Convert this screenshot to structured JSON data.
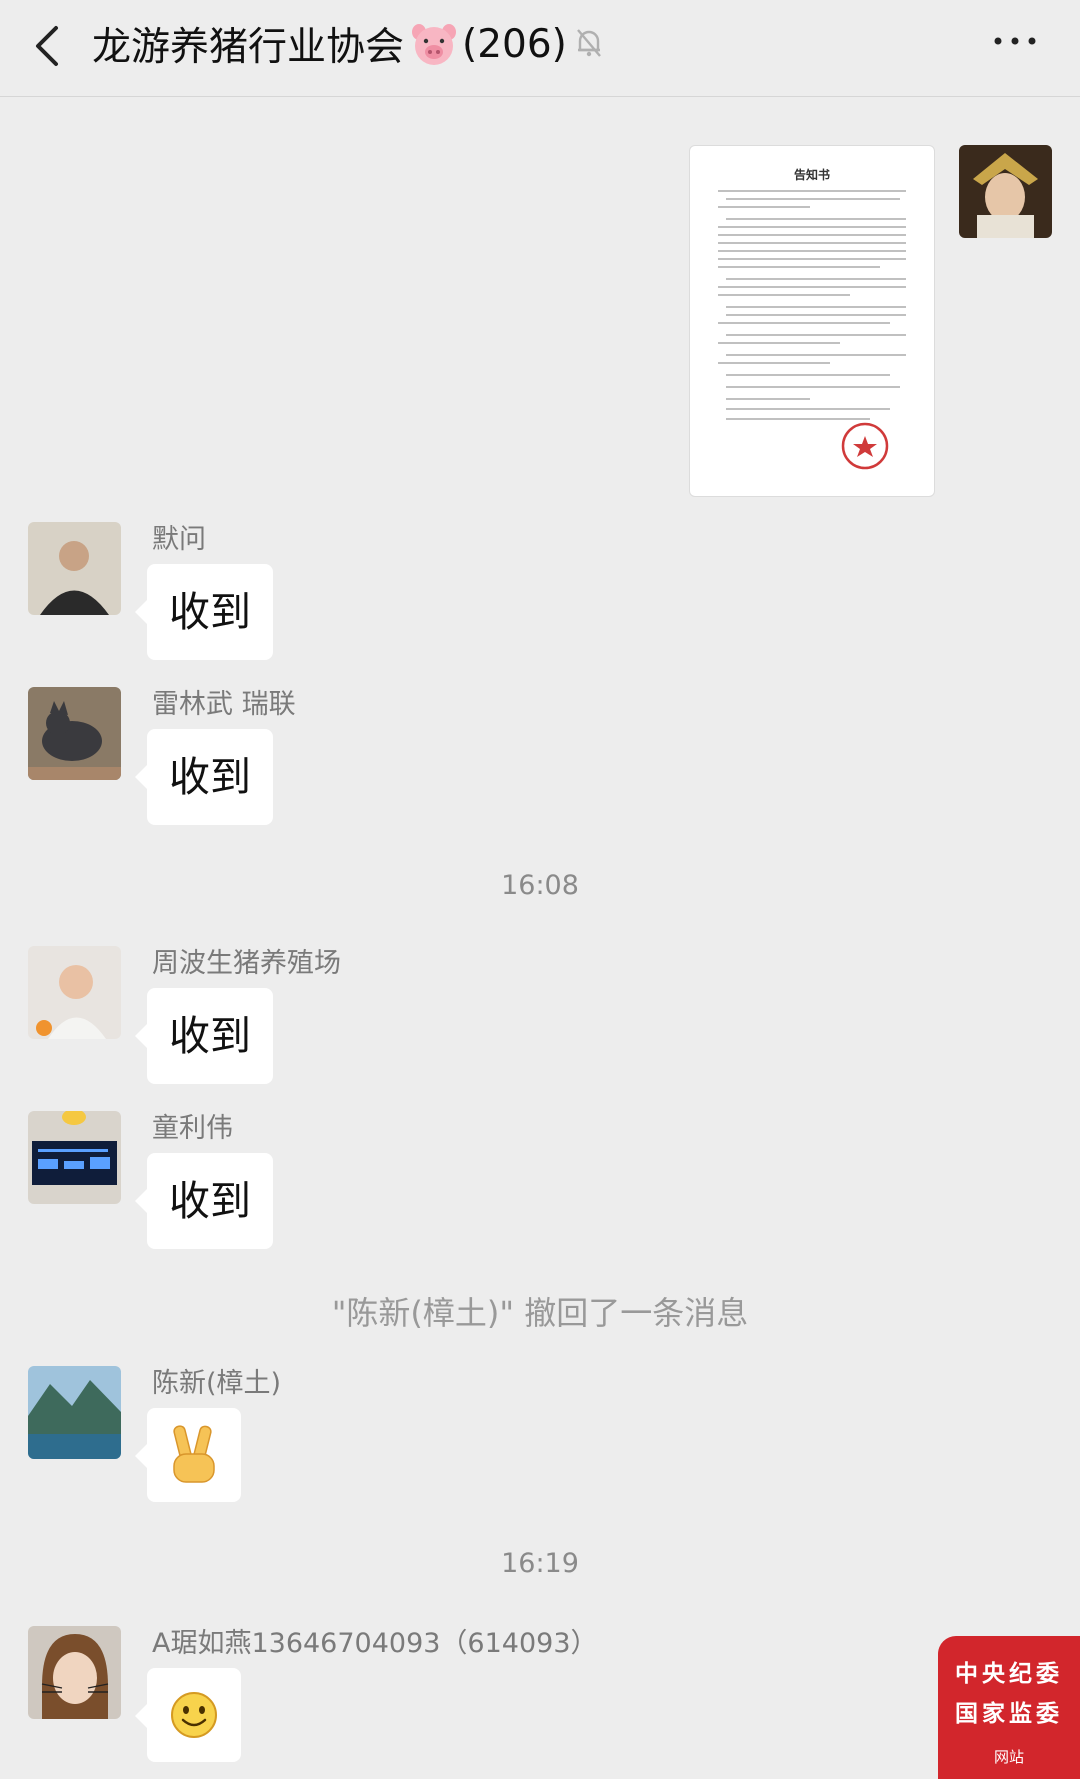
{
  "header": {
    "title": "龙游养猪行业协会",
    "member_count": "(206)",
    "title_icon": "pig-face-emoji",
    "mute_icon": "bell-slash-icon",
    "more_icon": "more-dots-icon"
  },
  "self_message": {
    "document_title": "告知书"
  },
  "messages": [
    {
      "sender": "默问",
      "text": "收到"
    },
    {
      "sender": "雷林武   瑞联",
      "text": "收到"
    },
    {
      "sender": "周波生猪养殖场",
      "text": "收到"
    },
    {
      "sender": "童利伟",
      "text": "收到"
    },
    {
      "sender": "陈新(樟土)",
      "emoji": "victory-hand-emoji"
    },
    {
      "sender": "A琚如燕13646704093（614093）",
      "emoji": "smiling-face-emoji"
    }
  ],
  "timestamps": [
    "16:08",
    "16:19"
  ],
  "recall_notice": "\"陈新(樟土)\" 撤回了一条消息",
  "watermark": {
    "line1": "中央纪委",
    "line2": "国家监委",
    "line3": "网站"
  },
  "colors": {
    "background": "#ededed",
    "bubble": "#ffffff",
    "watermark_red": "#d2262c"
  }
}
